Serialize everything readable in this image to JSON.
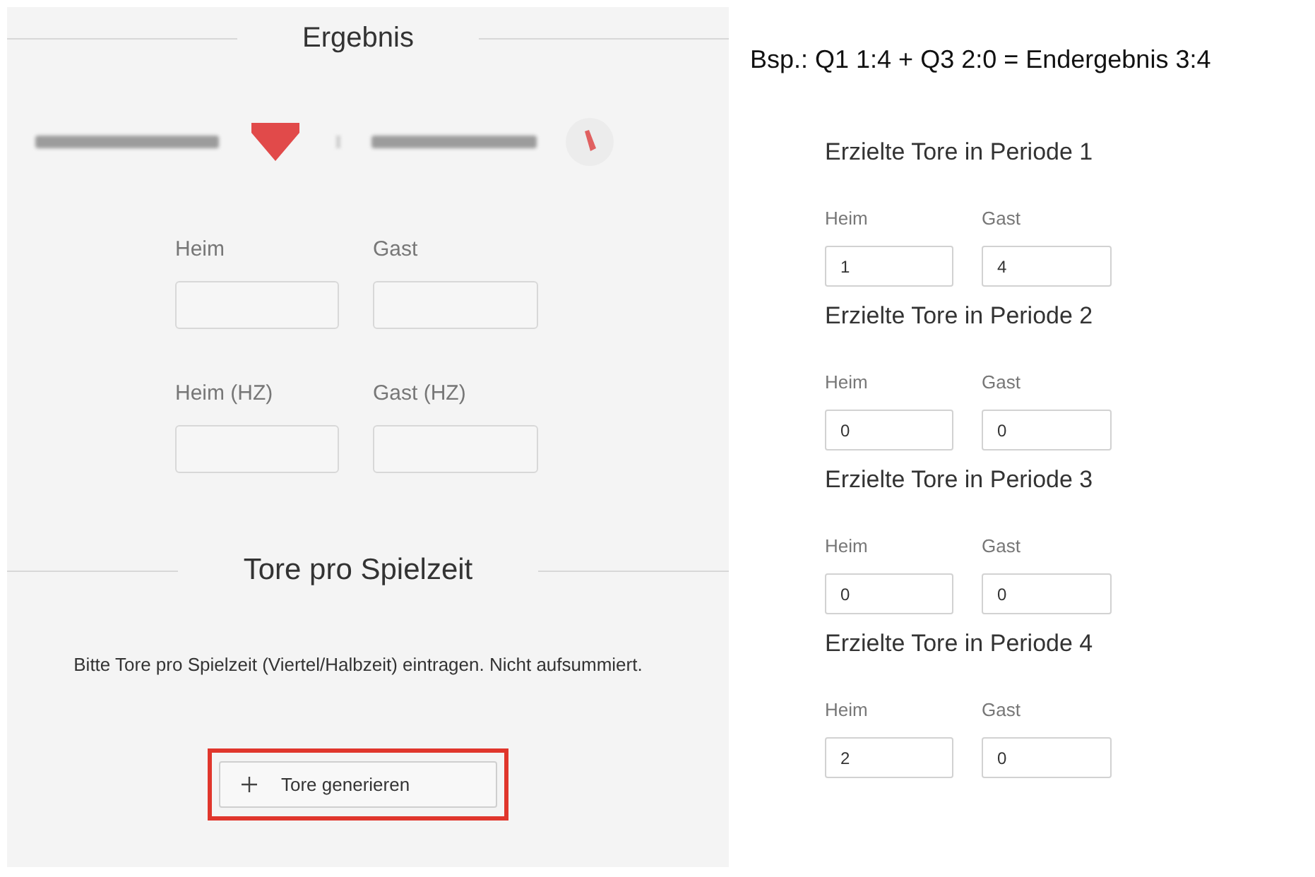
{
  "result_section": {
    "title": "Ergebnis",
    "fields": [
      {
        "label": "Heim"
      },
      {
        "label": "Gast"
      },
      {
        "label": "Heim (HZ)"
      },
      {
        "label": "Gast (HZ)"
      }
    ]
  },
  "goals_section": {
    "title": "Tore pro Spielzeit",
    "hint": "Bitte Tore pro Spielzeit (Viertel/Halbzeit) eintragen. Nicht aufsummiert.",
    "button": {
      "label": "Tore generieren",
      "highlighted": true
    }
  },
  "example": "Bsp.: Q1 1:4 + Q3 2:0 = Endergebnis 3:4",
  "periods": [
    {
      "title": "Erzielte Tore in Periode 1",
      "fields": [
        {
          "label": "Heim",
          "value": "1"
        },
        {
          "label": "Gast",
          "value": "4"
        }
      ]
    },
    {
      "title": "Erzielte Tore in Periode 2",
      "fields": [
        {
          "label": "Heim",
          "value": "0"
        },
        {
          "label": "Gast",
          "value": "0"
        }
      ]
    },
    {
      "title": "Erzielte Tore in Periode 3",
      "fields": [
        {
          "label": "Heim",
          "value": "0"
        },
        {
          "label": "Gast",
          "value": "0"
        }
      ]
    },
    {
      "title": "Erzielte Tore in Periode 4",
      "fields": [
        {
          "label": "Heim",
          "value": "2"
        },
        {
          "label": "Gast",
          "value": "0"
        }
      ]
    }
  ]
}
